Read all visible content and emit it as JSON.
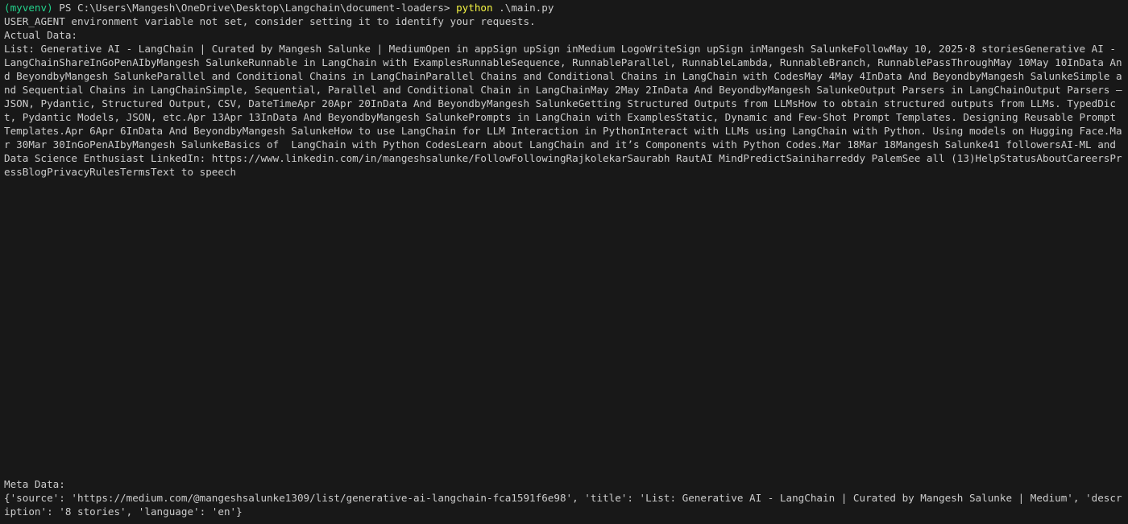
{
  "colors": {
    "background": "#181818",
    "foreground": "#cccccc",
    "env_prefix": "#23d18b",
    "command": "#f5f543"
  },
  "prompt": {
    "env": "(myvenv)",
    "path": " PS C:\\Users\\Mangesh\\OneDrive\\Desktop\\Langchain\\document-loaders> ",
    "command": "python",
    "args": " .\\main.py"
  },
  "output": {
    "warning": "USER_AGENT environment variable not set, consider setting it to identify your requests.",
    "actual_label": "Actual Data:",
    "actual_text": "List: Generative AI - LangChain | Curated by Mangesh Salunke | MediumOpen in appSign upSign inMedium LogoWriteSign upSign inMangesh SalunkeFollowMay 10, 2025·8 storiesGenerative AI - LangChainShareInGoPenAIbyMangesh SalunkeRunnable in LangChain with ExamplesRunnableSequence, RunnableParallel, RunnableLambda, RunnableBranch, RunnablePassThroughMay 10May 10InData And BeyondbyMangesh SalunkeParallel and Conditional Chains in LangChainParallel Chains and Conditional Chains in LangChain with CodesMay 4May 4InData And BeyondbyMangesh SalunkeSimple and Sequential Chains in LangChainSimple, Sequential, Parallel and Conditional Chain in LangChainMay 2May 2InData And BeyondbyMangesh SalunkeOutput Parsers in LangChainOutput Parsers — JSON, Pydantic, Structured Output, CSV, DateTimeApr 20Apr 20InData And BeyondbyMangesh SalunkeGetting Structured Outputs from LLMsHow to obtain structured outputs from LLMs. TypedDict, Pydantic Models, JSON, etc.Apr 13Apr 13InData And BeyondbyMangesh SalunkePrompts in LangChain with ExamplesStatic, Dynamic and Few-Shot Prompt Templates. Designing Reusable Prompt Templates.Apr 6Apr 6InData And BeyondbyMangesh SalunkeHow to use LangChain for LLM Interaction in PythonInteract with LLMs using LangChain with Python. Using models on Hugging Face.Mar 30Mar 30InGoPenAIbyMangesh SalunkeBasics of  LangChain with Python CodesLearn about LangChain and it’s Components with Python Codes.Mar 18Mar 18Mangesh Salunke41 followersAI-ML and Data Science Enthusiast LinkedIn: https://www.linkedin.com/in/mangeshsalunke/FollowFollowingRajkolekarSaurabh RautAI MindPredictSainiharreddy PalemSee all (13)HelpStatusAboutCareersPressBlogPrivacyRulesTermsText to speech",
    "meta_label": "Meta Data:",
    "meta_text": "{'source': 'https://medium.com/@mangeshsalunke1309/list/generative-ai-langchain-fca1591f6e98', 'title': 'List: Generative AI - LangChain | Curated by Mangesh Salunke | Medium', 'description': '8 stories', 'language': 'en'}"
  }
}
